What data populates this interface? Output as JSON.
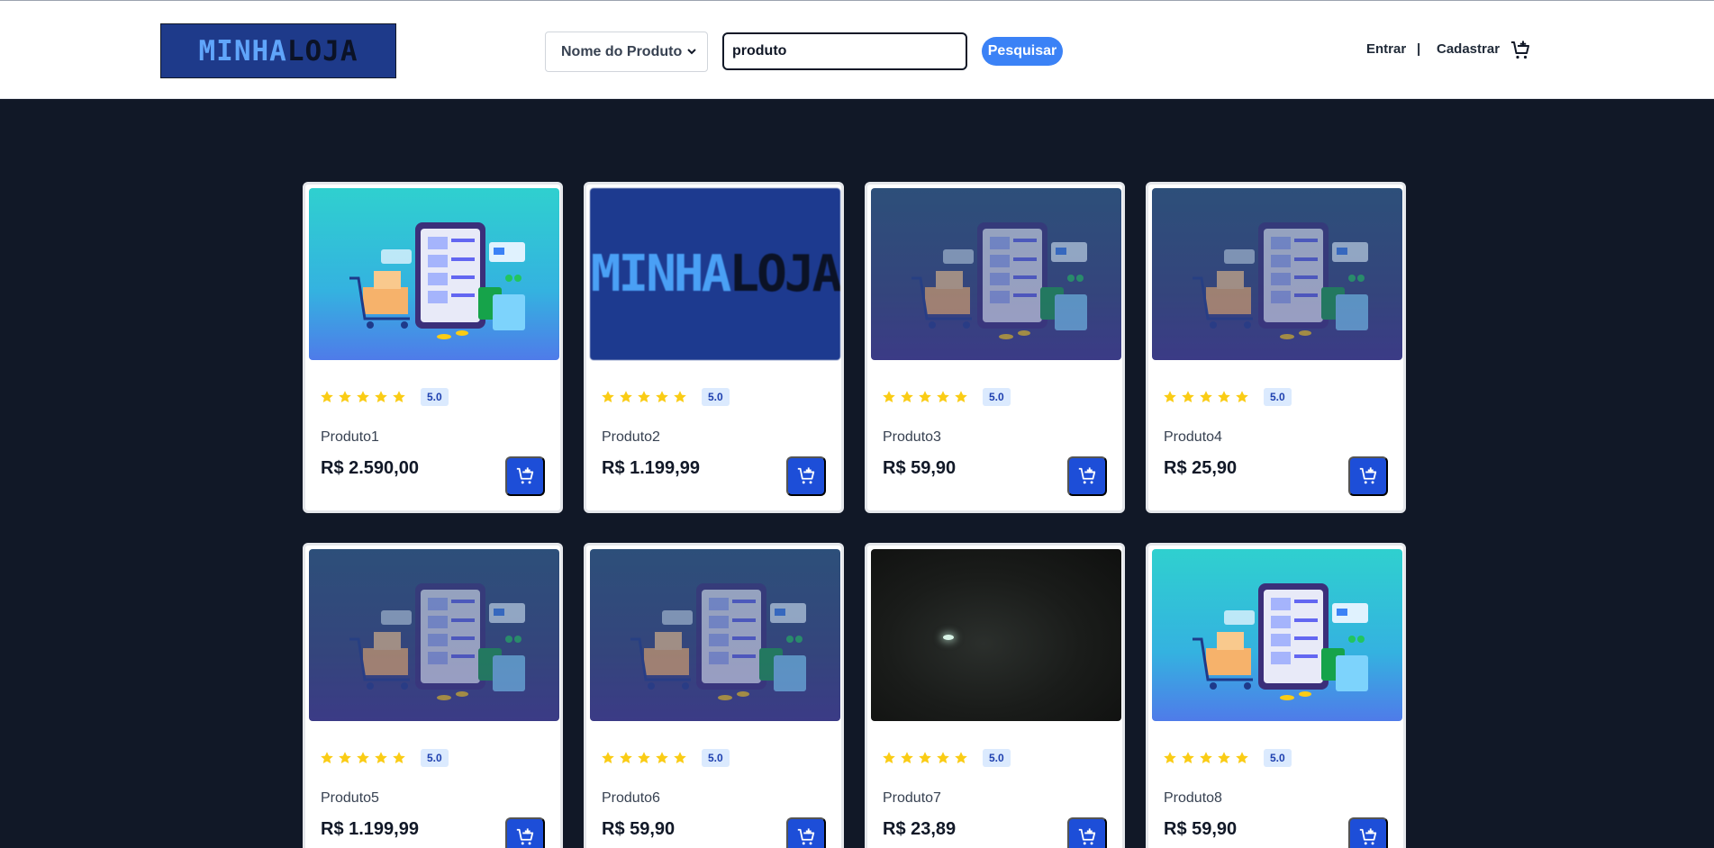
{
  "header": {
    "logo": {
      "part1": "MINHA",
      "part2": "LOJA"
    },
    "filter_select": {
      "selected": "Nome do Produto"
    },
    "search": {
      "value": "produto"
    },
    "search_button": "Pesquisar",
    "login": "Entrar",
    "separator": "|",
    "register": "Cadastrar",
    "cart_icon": "cart-plus-icon"
  },
  "products": [
    {
      "name": "Produto1",
      "price": "R$ 2.590,00",
      "rating": "5.0",
      "stars": 5,
      "image": "store-illustration"
    },
    {
      "name": "Produto2",
      "price": "R$ 1.199,99",
      "rating": "5.0",
      "stars": 5,
      "image": "logo-image"
    },
    {
      "name": "Produto3",
      "price": "R$ 59,90",
      "rating": "5.0",
      "stars": 5,
      "image": "store-illustration-dim"
    },
    {
      "name": "Produto4",
      "price": "R$ 25,90",
      "rating": "5.0",
      "stars": 5,
      "image": "store-illustration-dim"
    },
    {
      "name": "Produto5",
      "price": "R$ 1.199,99",
      "rating": "5.0",
      "stars": 5,
      "image": "store-illustration-dim"
    },
    {
      "name": "Produto6",
      "price": "R$ 59,90",
      "rating": "5.0",
      "stars": 5,
      "image": "store-illustration-dim"
    },
    {
      "name": "Produto7",
      "price": "R$ 23,89",
      "rating": "5.0",
      "stars": 5,
      "image": "dark-photo"
    },
    {
      "name": "Produto8",
      "price": "R$ 59,90",
      "rating": "5.0",
      "stars": 5,
      "image": "store-illustration"
    }
  ],
  "colors": {
    "page_bg": "#111827",
    "accent": "#1d4ed8",
    "search_button": "#3b82f6",
    "star": "#facc15",
    "badge_bg": "#dbeafe"
  }
}
